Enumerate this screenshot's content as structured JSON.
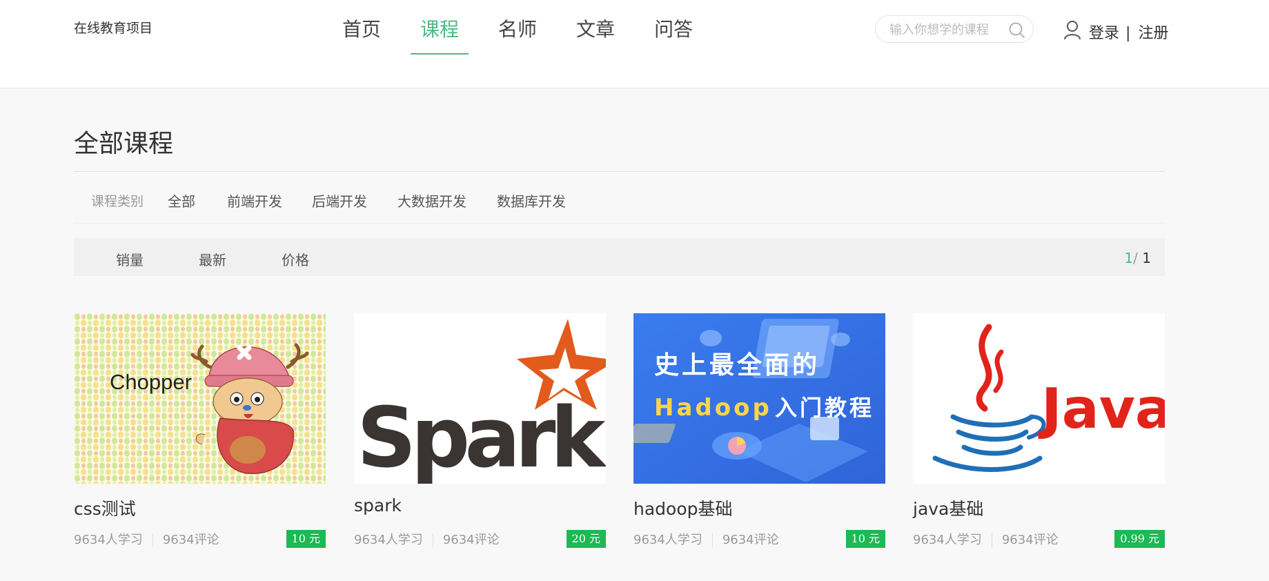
{
  "header": {
    "brand": "在线教育项目",
    "nav": [
      {
        "label": "首页",
        "active": false
      },
      {
        "label": "课程",
        "active": true
      },
      {
        "label": "名师",
        "active": false
      },
      {
        "label": "文章",
        "active": false
      },
      {
        "label": "问答",
        "active": false
      }
    ],
    "search": {
      "placeholder": "输入你想学的课程",
      "value": ""
    },
    "auth": {
      "login": "登录",
      "separator": "|",
      "register": "注册"
    }
  },
  "page": {
    "title": "全部课程"
  },
  "filters": {
    "category_label": "课程类别",
    "categories": [
      "全部",
      "前端开发",
      "后端开发",
      "大数据开发",
      "数据库开发"
    ]
  },
  "sort": {
    "options": [
      "销量",
      "最新",
      "价格"
    ],
    "pager": {
      "current": "1",
      "separator": "/",
      "total": "1"
    }
  },
  "courses": [
    {
      "title": "css测试",
      "learners": "9634人学习",
      "comments": "9634评论",
      "price": "10 元",
      "image_text": [
        "Chopper"
      ]
    },
    {
      "title": "spark",
      "learners": "9634人学习",
      "comments": "9634评论",
      "price": "20 元",
      "image_text": [
        "Spark"
      ]
    },
    {
      "title": "hadoop基础",
      "learners": "9634人学习",
      "comments": "9634评论",
      "price": "10 元",
      "image_text": [
        "史上最全面的",
        "Hadoop",
        "入门教程"
      ]
    },
    {
      "title": "java基础",
      "learners": "9634人学习",
      "comments": "9634评论",
      "price": "0.99 元",
      "image_text": [
        "Java"
      ]
    }
  ],
  "colors": {
    "accent": "#4cba84",
    "price_badge": "#1cb954",
    "hadoop_bg": "#3a7cf0",
    "java_red": "#e2231a",
    "java_blue": "#1f6fb7",
    "spark_orange": "#e25a1c"
  }
}
